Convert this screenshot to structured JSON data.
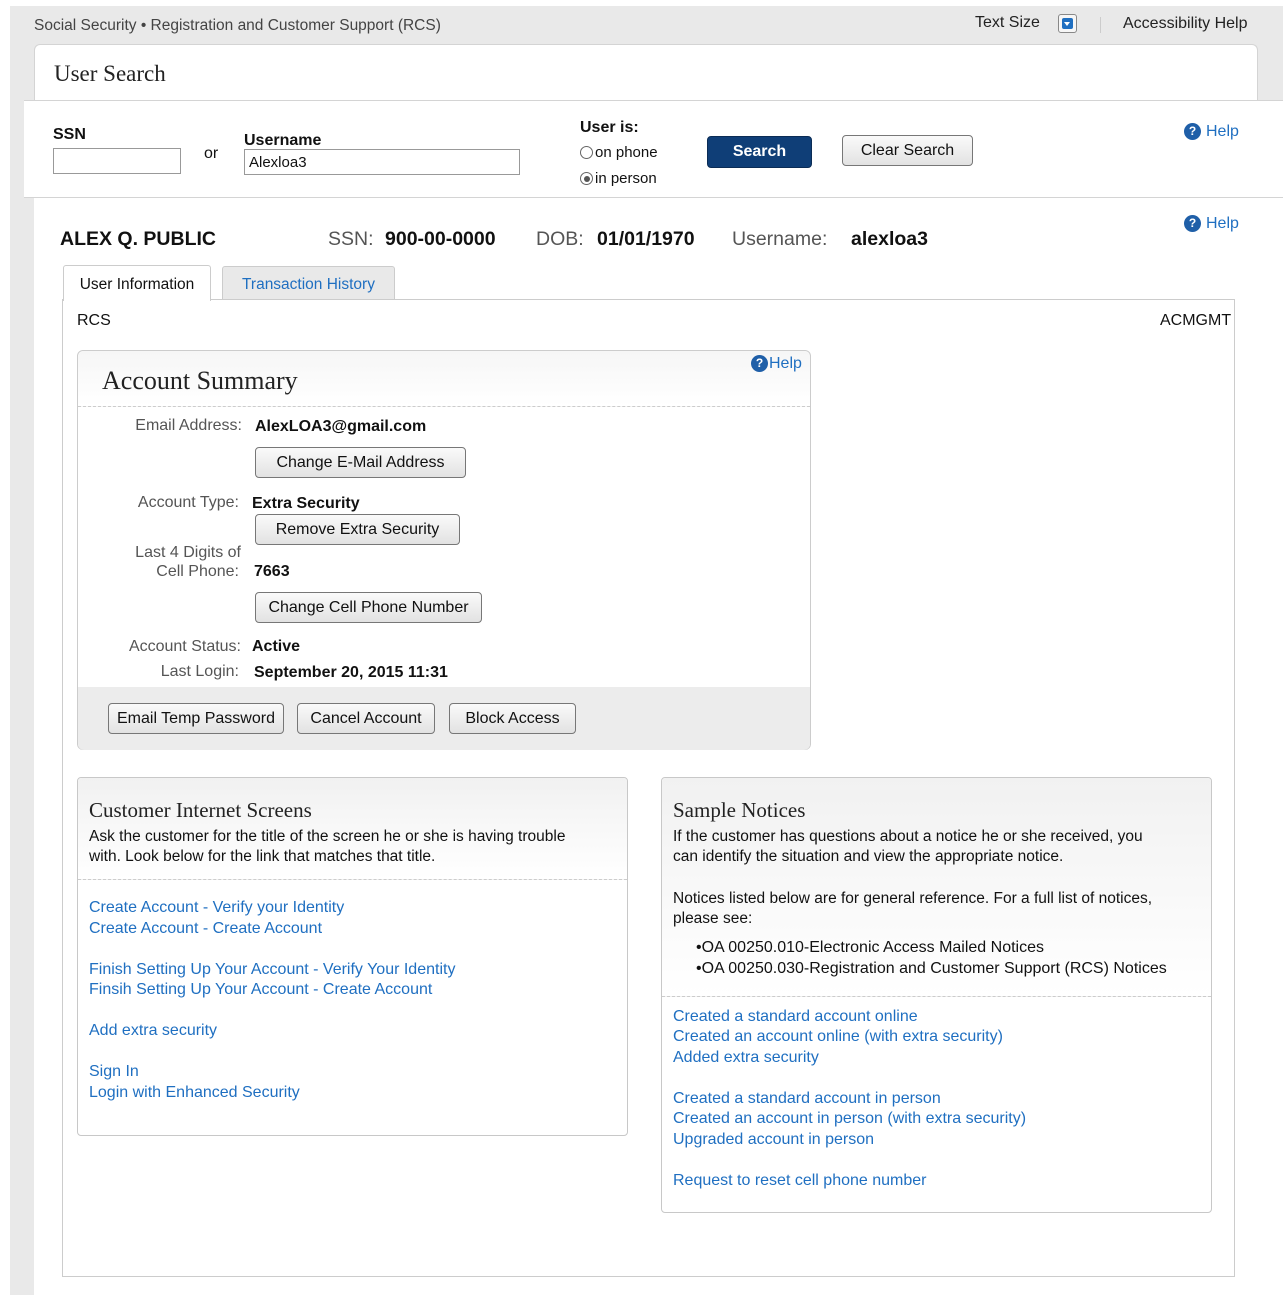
{
  "topbar": {
    "app_title": "Social Security • Registration and Customer Support (RCS)",
    "text_size": "Text Size",
    "accessibility_help": "Accessibility Help"
  },
  "panel": {
    "title": "User Search"
  },
  "search": {
    "ssn_label": "SSN",
    "ssn_value": "",
    "or_label": "or",
    "username_label": "Username",
    "username_value": "Alexloa3",
    "user_is_label": "User is:",
    "options": [
      {
        "label": "on phone",
        "selected": false
      },
      {
        "label": "in person",
        "selected": true
      }
    ],
    "search_button": "Search",
    "clear_button": "Clear Search",
    "help": "Help"
  },
  "user": {
    "name": "ALEX Q. PUBLIC",
    "ssn_label": "SSN:",
    "ssn": "900-00-0000",
    "dob_label": "DOB:",
    "dob": "01/01/1970",
    "username_label": "Username:",
    "username": "alexloa3",
    "help": "Help"
  },
  "tabs": [
    {
      "label": "User Information",
      "active": true
    },
    {
      "label": "Transaction History",
      "active": false
    }
  ],
  "tab_content": {
    "left_label": "RCS",
    "right_label": "ACMGMT"
  },
  "account_summary": {
    "title": "Account Summary",
    "help": "Help",
    "email_label": "Email Address:",
    "email": "AlexLOA3@gmail.com",
    "change_email_button": "Change E-Mail Address",
    "account_type_label": "Account Type:",
    "account_type": "Extra Security",
    "remove_security_button": "Remove Extra Security",
    "cell_label_line1": "Last 4 Digits of",
    "cell_label_line2": "Cell Phone:",
    "cell_digits": "7663",
    "change_cell_button": "Change Cell Phone Number",
    "status_label": "Account Status:",
    "status": "Active",
    "last_login_label": "Last Login:",
    "last_login": "September 20, 2015 11:31",
    "footer_buttons": {
      "email_temp": "Email Temp Password",
      "cancel": "Cancel Account",
      "block": "Block Access"
    }
  },
  "customer_screens": {
    "title": "Customer Internet Screens",
    "desc_line1": "Ask the customer for the title of the screen he or she is having trouble",
    "desc_line2": "with. Look below for the link that matches that title.",
    "links": [
      "Create Account - Verify your Identity",
      "Create Account - Create Account",
      "Finish Setting Up Your Account - Verify Your Identity",
      "Finsih Setting Up Your Account - Create Account",
      "Add extra security",
      "Sign In",
      "Login with Enhanced Security"
    ]
  },
  "sample_notices": {
    "title": "Sample Notices",
    "desc_line1": "If the customer has questions about a notice he or she received, you",
    "desc_line2": "can identify the situation and view the appropriate notice.",
    "desc_line3": "Notices listed below are for general reference. For a full list of notices,",
    "desc_line4": "please see:",
    "bullets": [
      "•OA 00250.010-Electronic Access Mailed Notices",
      "•OA 00250.030-Registration and Customer Support (RCS) Notices"
    ],
    "links": [
      "Created a standard account online",
      "Created an account online (with extra security)",
      "Added extra security",
      "Created a standard account in person",
      "Created an account in person (with extra security)",
      "Upgraded account in person",
      "Request to reset cell phone number"
    ]
  }
}
